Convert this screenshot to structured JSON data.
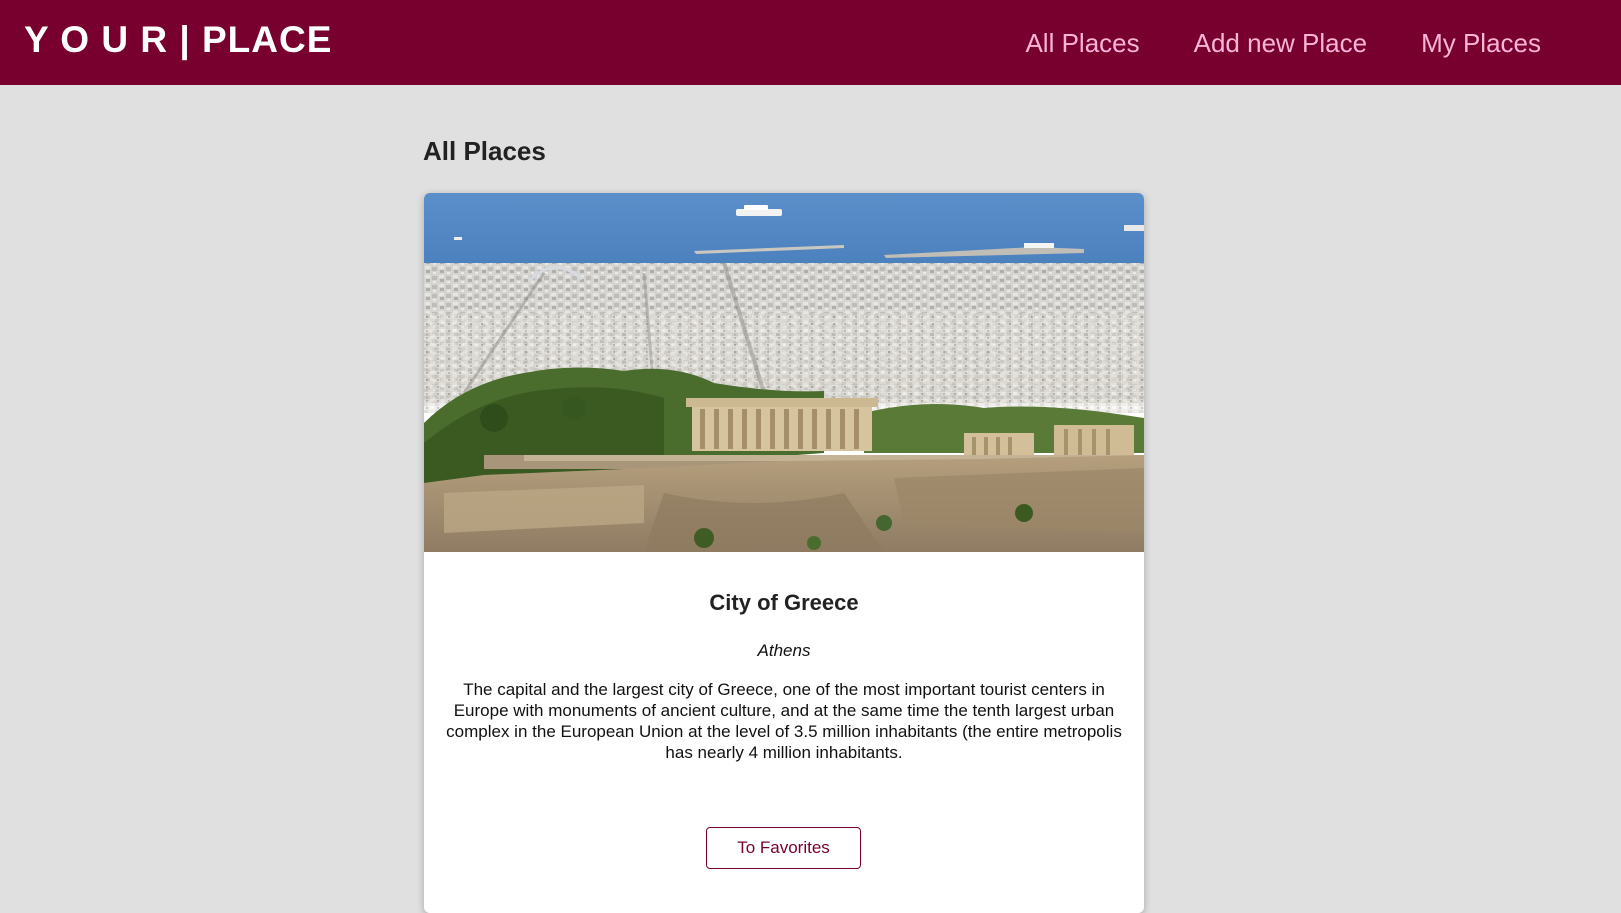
{
  "header": {
    "logo": "Y O U R | PLACE",
    "nav": [
      "All Places",
      "Add new Place",
      "My Places"
    ],
    "colors": {
      "background": "#77002e",
      "nav_link": "#fab4d8",
      "logo": "#ffffff"
    }
  },
  "main": {
    "title": "All Places",
    "places": [
      {
        "image_alt": "Acropolis overlooking Athens and the sea",
        "title": "City of Greece",
        "address": "Athens",
        "description": "The capital and the largest city of Greece, one of the most important tourist centers in Europe with monuments of ancient culture, and at the same time the tenth largest urban complex in the European Union at the level of 3.5 million inhabitants (the entire metropolis has nearly 4 million inhabitants.",
        "favorite_button": "To Favorites"
      }
    ]
  },
  "colors": {
    "page_background": "#e0e0e0",
    "card_background": "#ffffff",
    "accent": "#77002e"
  }
}
